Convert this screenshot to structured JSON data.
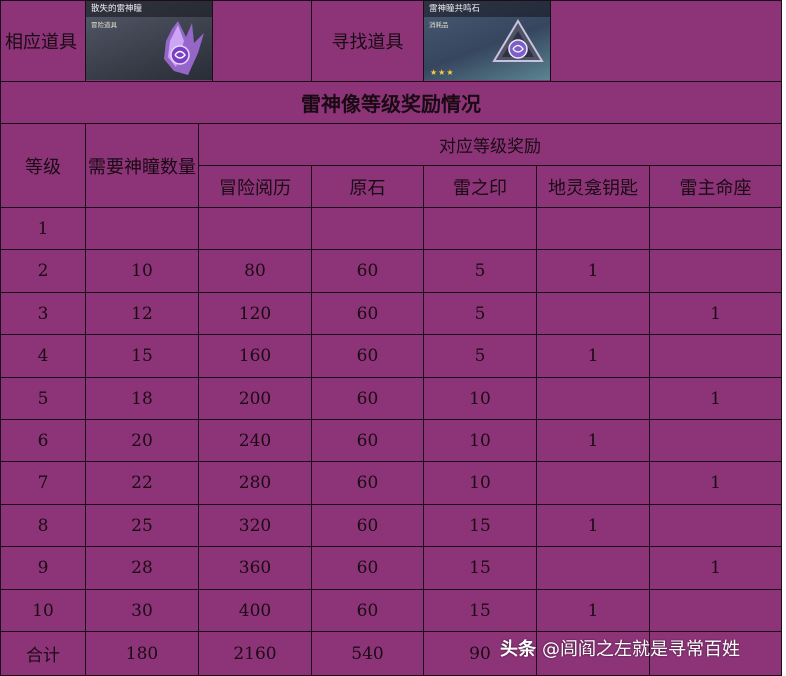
{
  "header_row": {
    "related_item_label": "相应道具",
    "find_item_label": "寻找道具"
  },
  "item_cards": [
    {
      "name": "散失的雷神瞳",
      "type": "冒险道具",
      "stars": ""
    },
    {
      "name": "雷神瞳共鸣石",
      "type": "消耗品",
      "stars": "★★★"
    }
  ],
  "table": {
    "title": "雷神像等级奖励情况",
    "level_header": "等级",
    "required_header": "需要神瞳数量",
    "rewards_group_header": "对应等级奖励",
    "reward_headers": [
      "冒险阅历",
      "原石",
      "雷之印",
      "地灵龛钥匙",
      "雷主命座"
    ],
    "rows": [
      [
        "1",
        "",
        "",
        "",
        "",
        "",
        ""
      ],
      [
        "2",
        "10",
        "80",
        "60",
        "5",
        "1",
        ""
      ],
      [
        "3",
        "12",
        "120",
        "60",
        "5",
        "",
        "1"
      ],
      [
        "4",
        "15",
        "160",
        "60",
        "5",
        "1",
        ""
      ],
      [
        "5",
        "18",
        "200",
        "60",
        "10",
        "",
        "1"
      ],
      [
        "6",
        "20",
        "240",
        "60",
        "10",
        "1",
        ""
      ],
      [
        "7",
        "22",
        "280",
        "60",
        "10",
        "",
        "1"
      ],
      [
        "8",
        "25",
        "320",
        "60",
        "15",
        "1",
        ""
      ],
      [
        "9",
        "28",
        "360",
        "60",
        "15",
        "",
        "1"
      ],
      [
        "10",
        "30",
        "400",
        "60",
        "15",
        "1",
        ""
      ]
    ],
    "total_row": [
      "合计",
      "180",
      "2160",
      "540",
      "90",
      "",
      ""
    ]
  },
  "watermark": {
    "brand": "头条",
    "handle": "@闾阎之左就是寻常百姓"
  },
  "colors": {
    "cell_background": "#8d3478",
    "grid_lines": "#1b0d17",
    "text": "#1a0a14"
  }
}
